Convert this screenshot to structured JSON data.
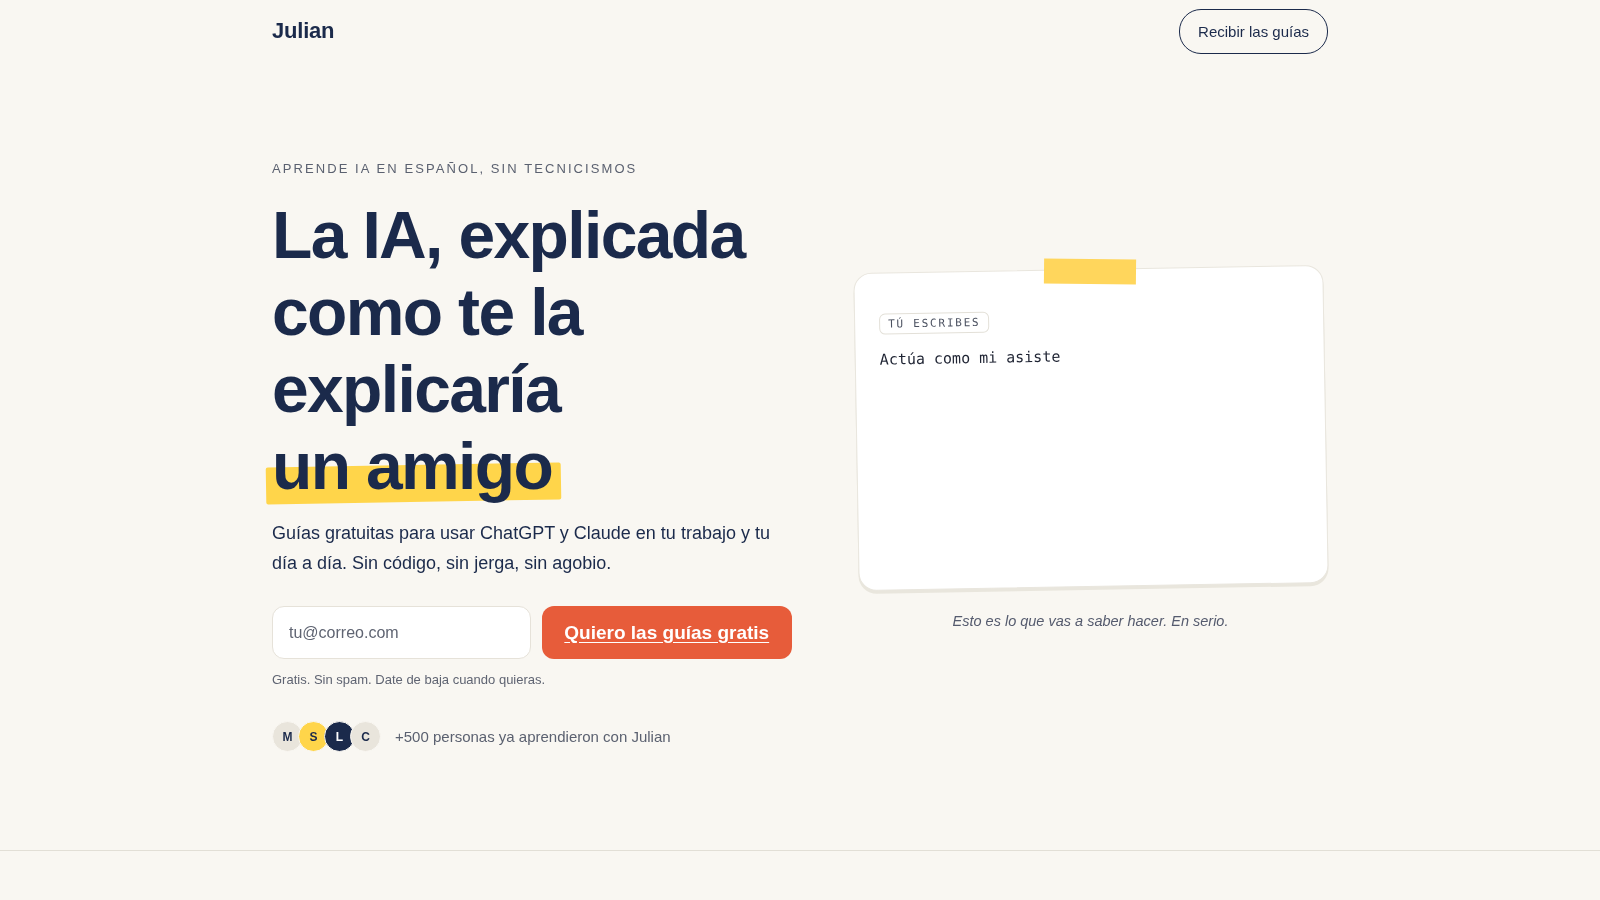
{
  "header": {
    "logo": "Julian",
    "cta": "Recibir las guías"
  },
  "hero": {
    "eyebrow": "APRENDE IA EN ESPAÑOL, SIN TECNICISMOS",
    "heading": "La IA, explicada como te la explicaría",
    "heading_highlight": "un amigo",
    "subtitle": "Guías gratuitas para usar ChatGPT y Claude en tu trabajo y tu día a día. Sin código, sin jerga, sin agobio.",
    "email": {
      "placeholder": "tu@correo.com"
    },
    "button": "Quiero las guías gratis",
    "note": "Gratis. Sin spam. Date de baja cuando quieras.",
    "social_proof": {
      "avatars": [
        {
          "initial": "M",
          "color": "#e9e5dc"
        },
        {
          "initial": "S",
          "color": "#ffd54a"
        },
        {
          "initial": "L",
          "color": "#1b2a4b"
        },
        {
          "initial": "C",
          "color": "#e9e5dc"
        }
      ],
      "text": "+500 personas ya aprendieron con Julian"
    }
  },
  "demo_card": {
    "badge": "TÚ ESCRIBES",
    "typed_text": "Actúa como mi asiste",
    "caption": "Esto es lo que vas a saber hacer. En serio."
  }
}
